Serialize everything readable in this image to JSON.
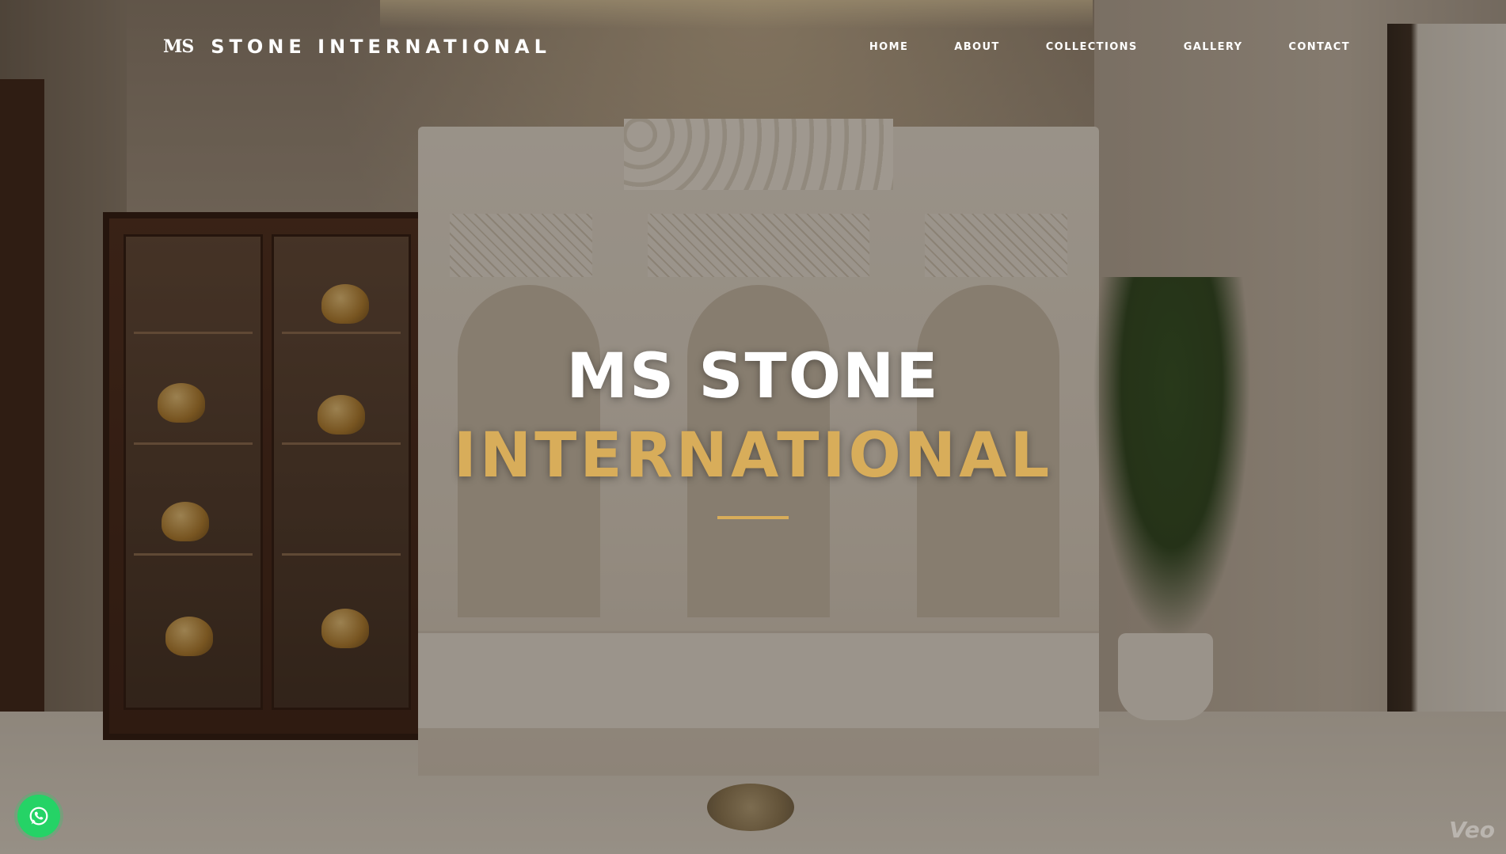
{
  "header": {
    "logo_mark": "MS",
    "brand_name": "STONE INTERNATIONAL"
  },
  "nav": {
    "items": [
      {
        "label": "HOME"
      },
      {
        "label": "ABOUT"
      },
      {
        "label": "COLLECTIONS"
      },
      {
        "label": "GALLERY"
      },
      {
        "label": "CONTACT"
      }
    ]
  },
  "hero": {
    "line1": "MS STONE",
    "line2": "INTERNATIONAL",
    "background_image": "marble-temple-interior"
  },
  "floating": {
    "whatsapp_icon": "whatsapp-icon",
    "watermark": "Veo"
  },
  "colors": {
    "accent_gold": "#d8ad5a",
    "whatsapp_green": "#25d366",
    "text_white": "#ffffff"
  }
}
